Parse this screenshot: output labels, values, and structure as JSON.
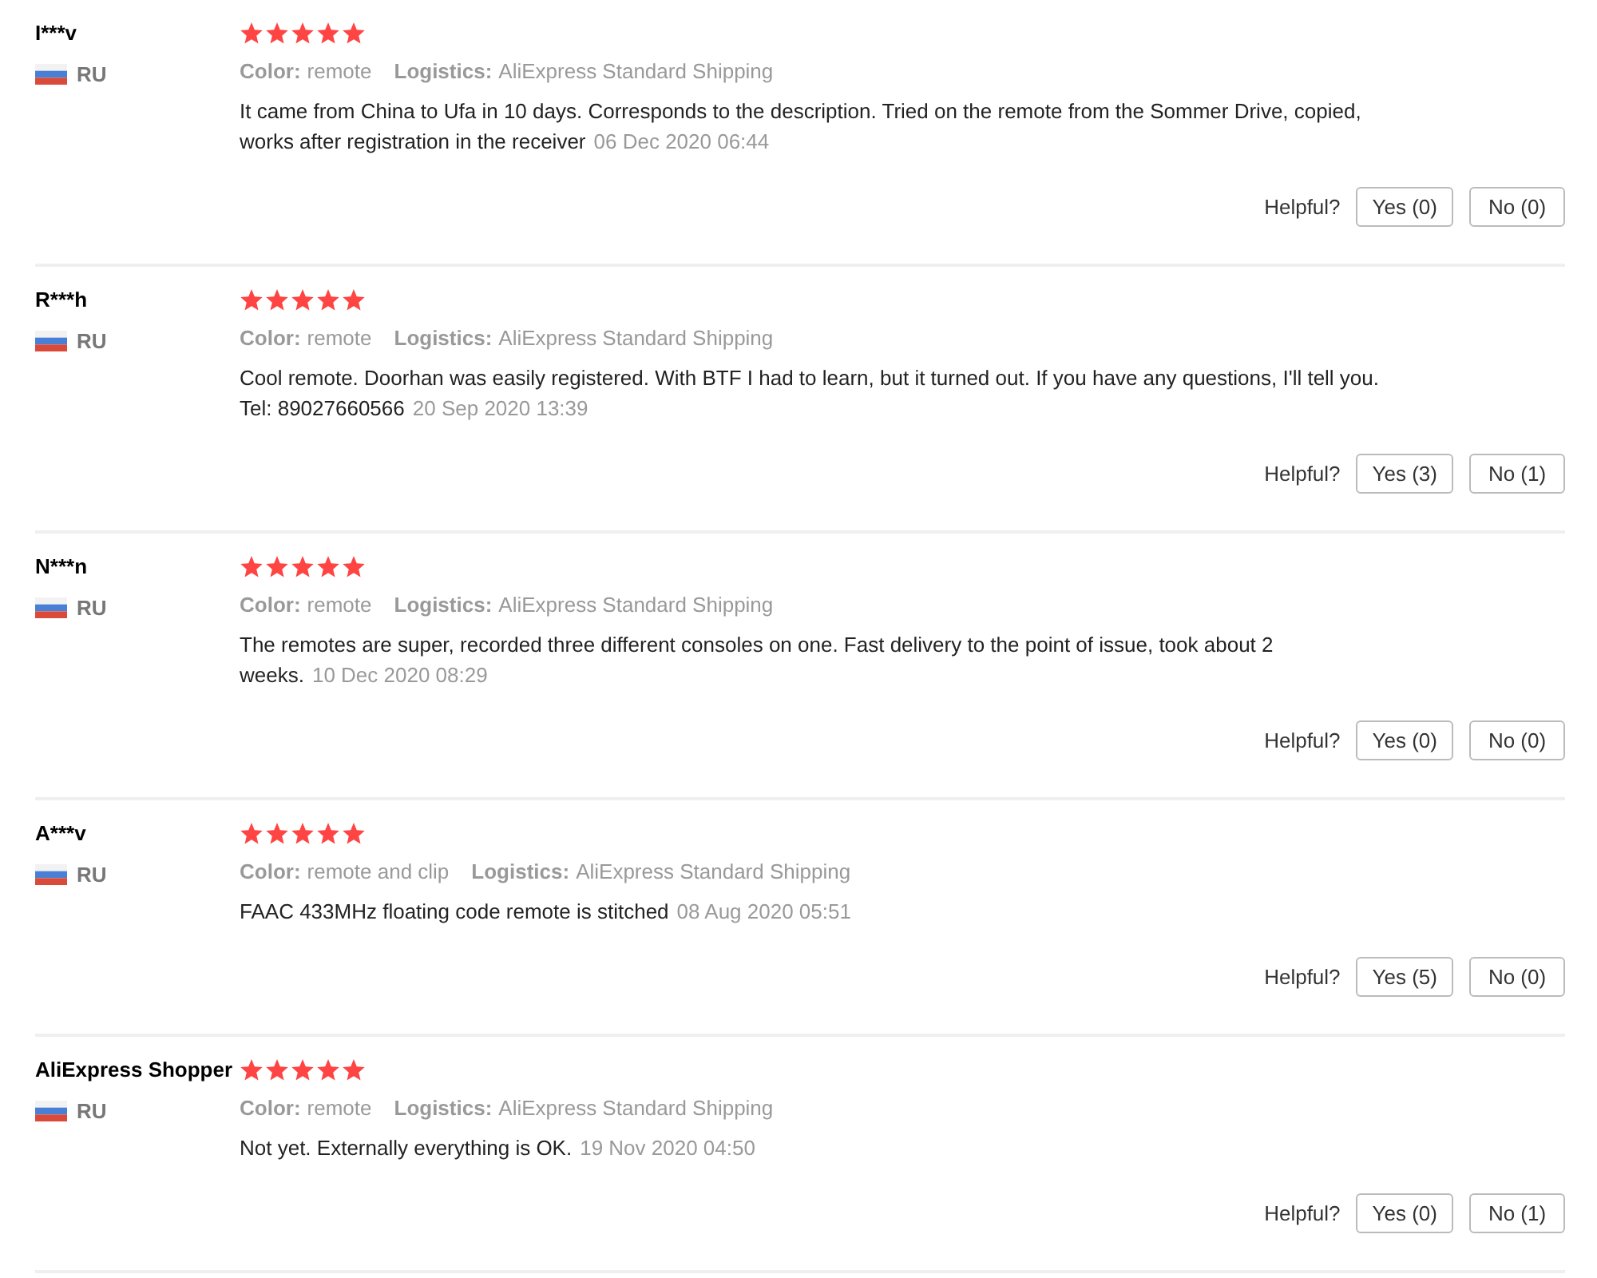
{
  "reviews": [
    {
      "name": "I***v",
      "country": "RU",
      "stars": 5,
      "color_label": "Color:",
      "color_value": "remote",
      "logistics_label": "Logistics:",
      "logistics_value": "AliExpress Standard Shipping",
      "text": "It came from China to Ufa in 10 days. Corresponds to the description. Tried on the remote from the Sommer Drive, copied, works after registration in the receiver",
      "date": "06 Dec 2020 06:44",
      "helpful": "Helpful?",
      "yes": "Yes (0)",
      "no": "No (0)"
    },
    {
      "name": "R***h",
      "country": "RU",
      "stars": 5,
      "color_label": "Color:",
      "color_value": "remote",
      "logistics_label": "Logistics:",
      "logistics_value": "AliExpress Standard Shipping",
      "text": "Cool remote. Doorhan was easily registered. With BTF I had to learn, but it turned out. If you have any questions, I'll tell you. Tel: 89027660566",
      "date": "20 Sep 2020 13:39",
      "helpful": "Helpful?",
      "yes": "Yes (3)",
      "no": "No (1)"
    },
    {
      "name": "N***n",
      "country": "RU",
      "stars": 5,
      "color_label": "Color:",
      "color_value": "remote",
      "logistics_label": "Logistics:",
      "logistics_value": "AliExpress Standard Shipping",
      "text": "The remotes are super, recorded three different consoles on one. Fast delivery to the point of issue, took about 2 weeks.",
      "date": "10 Dec 2020 08:29",
      "helpful": "Helpful?",
      "yes": "Yes (0)",
      "no": "No (0)"
    },
    {
      "name": "A***v",
      "country": "RU",
      "stars": 5,
      "color_label": "Color:",
      "color_value": "remote and clip",
      "logistics_label": "Logistics:",
      "logistics_value": "AliExpress Standard Shipping",
      "text": "FAAC 433MHz floating code remote is stitched",
      "date": "08 Aug 2020 05:51",
      "helpful": "Helpful?",
      "yes": "Yes (5)",
      "no": "No (0)"
    },
    {
      "name": "AliExpress Shopper",
      "country": "RU",
      "stars": 5,
      "color_label": "Color:",
      "color_value": "remote",
      "logistics_label": "Logistics:",
      "logistics_value": "AliExpress Standard Shipping",
      "text": "Not yet. Externally everything is OK.",
      "date": "19 Nov 2020 04:50",
      "helpful": "Helpful?",
      "yes": "Yes (0)",
      "no": "No (1)"
    }
  ]
}
